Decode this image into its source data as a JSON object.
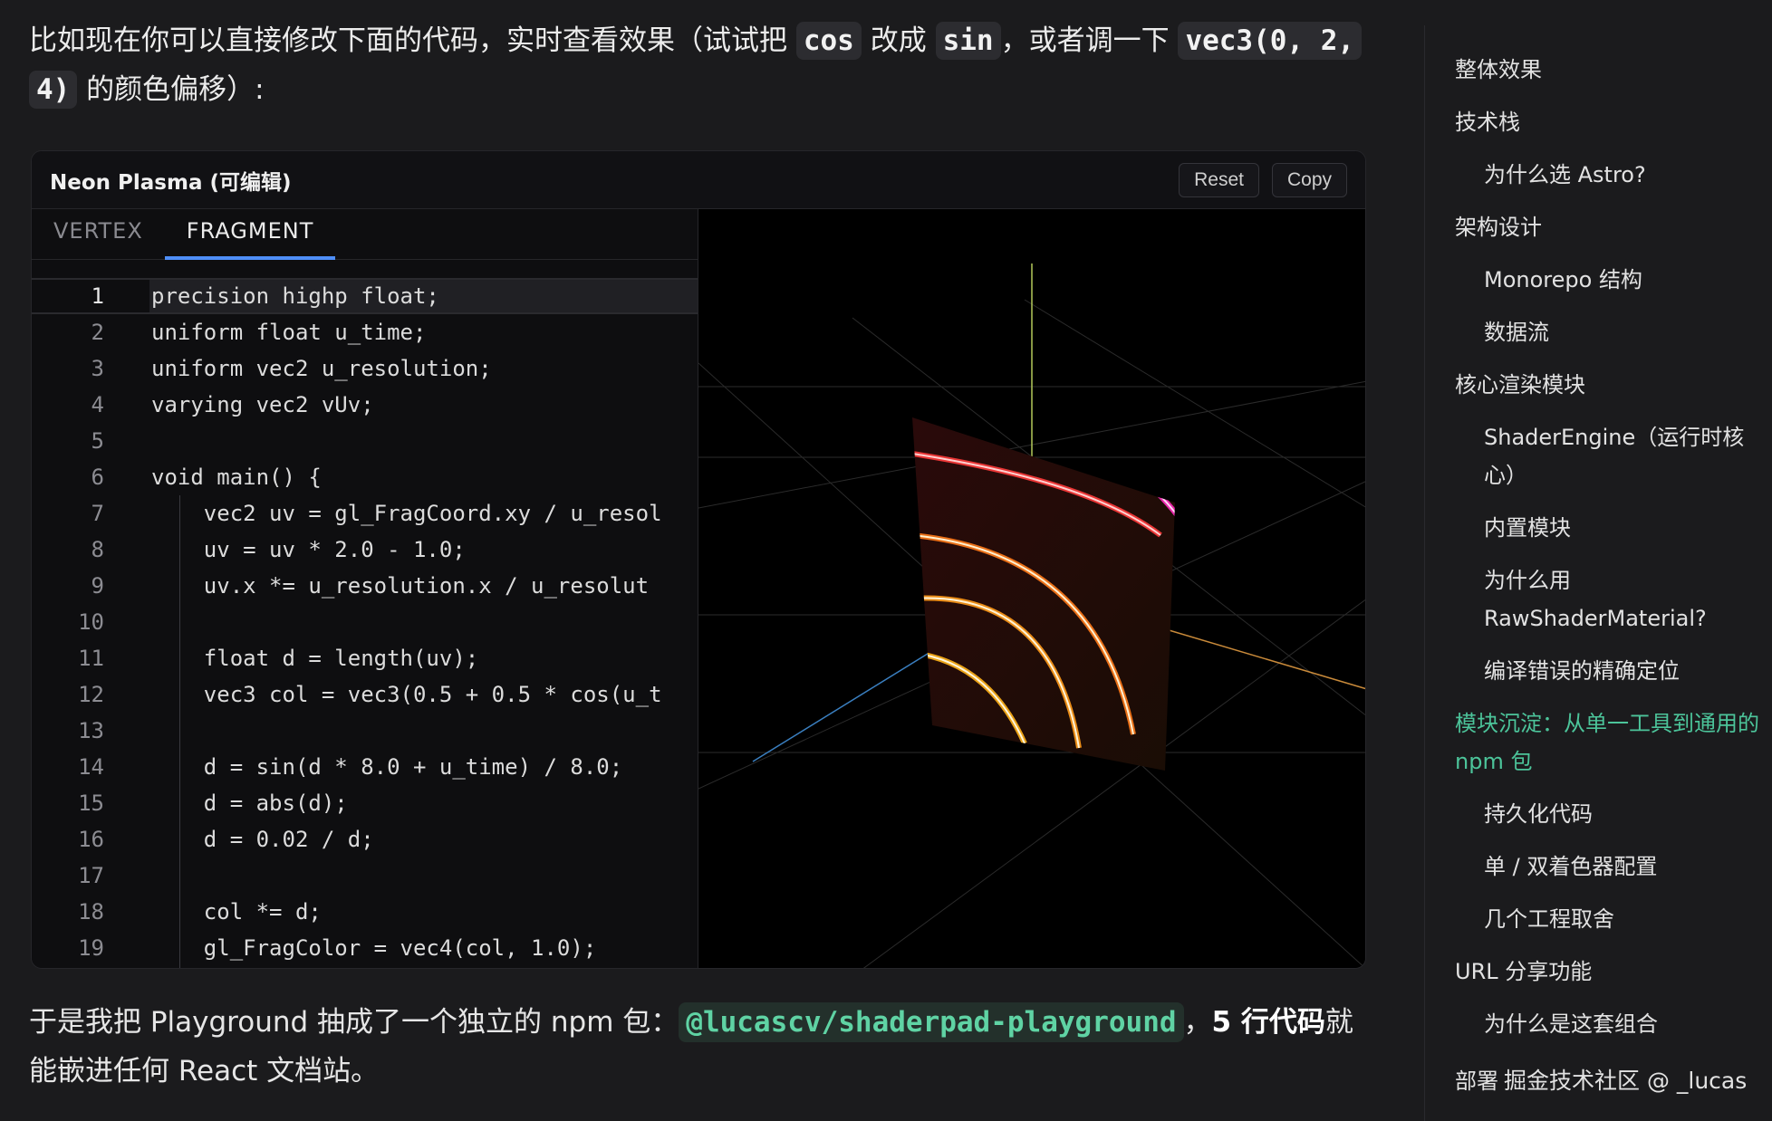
{
  "intro": {
    "p1": "比如现在你可以直接修改下面的代码，实时查看效果（试试把 ",
    "code1": "cos",
    "p2": " 改成 ",
    "code2": "sin",
    "p3": "，或者调一下 ",
    "code3a": "vec3(0, 2,",
    "code3b": "4)",
    "p4": " 的颜色偏移）:"
  },
  "playground": {
    "title": "Neon Plasma (可编辑)",
    "reset_label": "Reset",
    "copy_label": "Copy",
    "tabs": [
      {
        "label": "VERTEX",
        "active": false
      },
      {
        "label": "FRAGMENT",
        "active": true
      }
    ],
    "code_lines": [
      {
        "n": "1",
        "text": "precision highp float;"
      },
      {
        "n": "2",
        "text": "uniform float u_time;"
      },
      {
        "n": "3",
        "text": "uniform vec2 u_resolution;"
      },
      {
        "n": "4",
        "text": "varying vec2 vUv;"
      },
      {
        "n": "5",
        "text": ""
      },
      {
        "n": "6",
        "text": "void main() {"
      },
      {
        "n": "7",
        "text": "    vec2 uv = gl_FragCoord.xy / u_resol"
      },
      {
        "n": "8",
        "text": "    uv = uv * 2.0 - 1.0;"
      },
      {
        "n": "9",
        "text": "    uv.x *= u_resolution.x / u_resolut"
      },
      {
        "n": "10",
        "text": ""
      },
      {
        "n": "11",
        "text": "    float d = length(uv);"
      },
      {
        "n": "12",
        "text": "    vec3 col = vec3(0.5 + 0.5 * cos(u_t"
      },
      {
        "n": "13",
        "text": ""
      },
      {
        "n": "14",
        "text": "    d = sin(d * 8.0 + u_time) / 8.0;"
      },
      {
        "n": "15",
        "text": "    d = abs(d);"
      },
      {
        "n": "16",
        "text": "    d = 0.02 / d;"
      },
      {
        "n": "17",
        "text": ""
      },
      {
        "n": "18",
        "text": "    col *= d;"
      },
      {
        "n": "19",
        "text": "    gl_FragColor = vec4(col, 1.0);"
      }
    ]
  },
  "after": {
    "p1": "于是我把 Playground 抽成了一个独立的 npm 包：",
    "pkg": "@lucascv/shaderpad-playground",
    "p2": "，",
    "bold": "5 行代码",
    "p3": "就能嵌进任何 React 文档站。"
  },
  "toc": [
    {
      "label": "整体效果",
      "level": 1
    },
    {
      "label": "技术栈",
      "level": 1
    },
    {
      "label": "为什么选 Astro?",
      "level": 2
    },
    {
      "label": "架构设计",
      "level": 1
    },
    {
      "label": "Monorepo 结构",
      "level": 2
    },
    {
      "label": "数据流",
      "level": 2
    },
    {
      "label": "核心渲染模块",
      "level": 1
    },
    {
      "label": "ShaderEngine（运行时核心）",
      "level": 2
    },
    {
      "label": "内置模块",
      "level": 2
    },
    {
      "label": "为什么用 RawShaderMaterial?",
      "level": 2
    },
    {
      "label": "编译错误的精确定位",
      "level": 2
    },
    {
      "label": "模块沉淀：从单一工具到通用的 npm 包",
      "level": 1,
      "active": true
    },
    {
      "label": "持久化代码",
      "level": 2
    },
    {
      "label": "单 / 双着色器配置",
      "level": 2
    },
    {
      "label": "几个工程取舍",
      "level": 2
    },
    {
      "label": "URL 分享功能",
      "level": 1
    },
    {
      "label": "为什么是这套组合",
      "level": 2
    }
  ],
  "footer": {
    "label": "部署",
    "watermark": "掘金技术社区 @ _lucas"
  },
  "colors": {
    "accent_tab": "#4e8ef7",
    "active_toc": "#4cc49a",
    "package_text": "#5fd3a4"
  }
}
